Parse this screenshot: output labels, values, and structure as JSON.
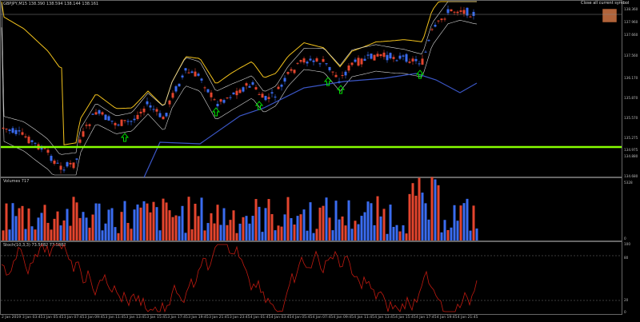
{
  "symbol_label": "GBPJPY,M15  138.390 138.594 138.144 138.161",
  "close_button_label": "Close all current symbol",
  "price_axis": [
    "138.360",
    "137.960",
    "137.660",
    "137.560",
    "136.170",
    "135.870",
    "135.570",
    "135.275",
    "134.975",
    "134.880",
    "134.680"
  ],
  "volume_panel": {
    "title": "Volumes 717",
    "scale": [
      "5328",
      "0"
    ]
  },
  "stoch_panel": {
    "title": "Stoch(10,3,3) 73.5882 73.5882",
    "scale": [
      "100",
      "80",
      "20",
      "0"
    ]
  },
  "time_axis": [
    "2 Jan 2019",
    "3 Jan 03:45",
    "3 Jan 05:45",
    "3 Jan 07:45",
    "3 Jan 09:45",
    "3 Jan 11:45",
    "3 Jan 13:45",
    "3 Jan 15:45",
    "3 Jan 17:45",
    "3 Jan 19:45",
    "3 Jan 21:45",
    "3 Jan 23:45",
    "4 Jan 01:45",
    "4 Jan 03:45",
    "4 Jan 05:45",
    "4 Jan 07:45",
    "4 Jan 09:45",
    "4 Jan 11:45",
    "4 Jan 13:45",
    "4 Jan 15:45",
    "4 Jan 17:45",
    "4 Jan 19:45",
    "4 Jan 21:45"
  ],
  "colors": {
    "bull": "#3a6cf0",
    "bear": "#e4452e",
    "bb_outer": "#f2c21c",
    "bb_inner": "#d8d8d8",
    "bb_lower": "#3b56c6",
    "support_line": "#86ff00",
    "arrow": "#00e000",
    "stoch": "#c01a10"
  },
  "signal_arrows_count": 7
}
